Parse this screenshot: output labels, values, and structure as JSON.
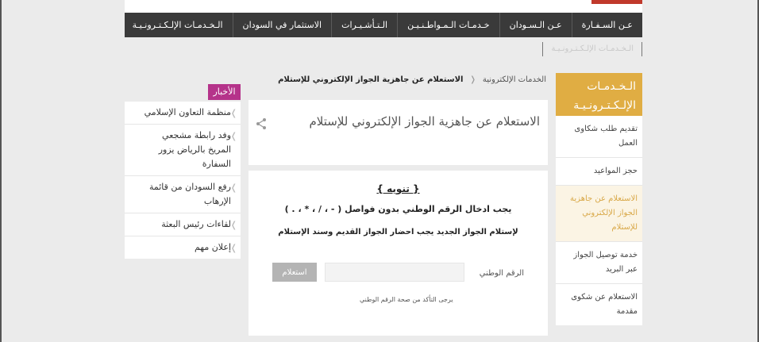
{
  "nav": {
    "items": [
      "عـن السـفـارة",
      "عـن الـسـودان",
      "خـدمـات الـمـواطـنـيـن",
      "الـتـأشـيـرات",
      "الاستثمار في السودان",
      "الـخـدمـات الإلـكـتـرونـيـة"
    ],
    "sub_item": "الـخـدمـات الإلـكـتـرونـيـة"
  },
  "sidebar": {
    "heading": "الـخـدمـات الإلـكـتـرونـيـة",
    "items": [
      "تقديم طلب شكاوى العمل",
      "حجز المواعيد",
      "الاستعلام عن جاهزية الجواز الإلكتروني للإستلام",
      "خدمة توصيل الجواز عبر البريد",
      "الاستعلام عن شكوى مقدمة"
    ]
  },
  "breadcrumb": {
    "parent": "الخدمات الإلكترونية",
    "current": "الاستعلام عن جاهزية الجواز الإلكتروني للإستلام"
  },
  "title": "الاستعلام عن جاهزية الجواز الإلكتروني للإستلام",
  "notice": {
    "title": "{ تنويه }",
    "line1": "يجب ادخال الرقم الوطني بدون فواصل ( - ، / ، * ، . )",
    "line2": "لإستلام الجواز الجديد يجب احضار الجواز القديم  وسند الإستلام"
  },
  "form": {
    "label": "الرقم الوطني",
    "input_value": "",
    "button": "استعلام",
    "hint": "يرجى التأكد من صحة الرقم الوطني"
  },
  "news": {
    "heading": "الأخبار",
    "items": [
      "منظمة التعاون الإسلامي",
      "وفد رابطة مشجعي المريخ بالرياض يزور السفارة",
      "رفع السودان من قائمة الإرهاب",
      "لقاءات رئيس البعثة",
      "إعلان مهم"
    ]
  },
  "colors": {
    "accent": "#e0ad43",
    "news": "#b5338a",
    "nav": "#3a3a3a"
  }
}
